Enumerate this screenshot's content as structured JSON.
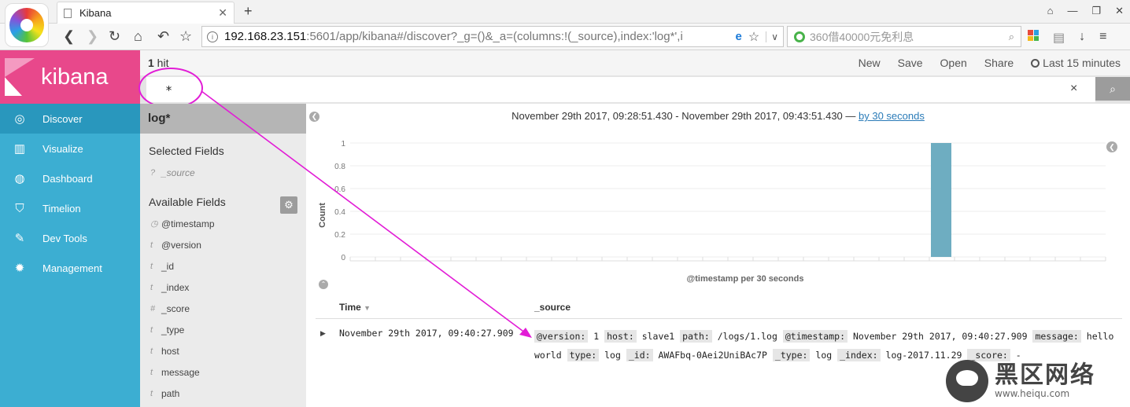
{
  "browser": {
    "tab_title": "Kibana",
    "tab_close": "✕",
    "new_tab": "+",
    "url_host": "192.168.23.151",
    "url_rest": ":5601/app/kibana#/discover?_g=()&_a=(columns:!(_source),index:'log*',i",
    "search_text": "360借40000元免利息"
  },
  "kibana": {
    "logo": "kibana",
    "nav": [
      {
        "label": "Discover",
        "icon": "compass-icon"
      },
      {
        "label": "Visualize",
        "icon": "bar-chart-icon"
      },
      {
        "label": "Dashboard",
        "icon": "gauge-icon"
      },
      {
        "label": "Timelion",
        "icon": "shield-icon"
      },
      {
        "label": "Dev Tools",
        "icon": "wrench-icon"
      },
      {
        "label": "Management",
        "icon": "gear-icon"
      }
    ],
    "hits_count": "1",
    "hits_label": " hit",
    "menu": {
      "new": "New",
      "save": "Save",
      "open": "Open",
      "share": "Share",
      "time": "Last 15 minutes"
    },
    "query": "*",
    "clear": "×",
    "index_pattern": "log*",
    "selected_fields_title": "Selected Fields",
    "selected_fields": [
      {
        "type": "?",
        "name": "_source"
      }
    ],
    "available_fields_title": "Available Fields",
    "available_fields": [
      {
        "type": "clock",
        "name": "@timestamp"
      },
      {
        "type": "t",
        "name": "@version"
      },
      {
        "type": "t",
        "name": "_id"
      },
      {
        "type": "t",
        "name": "_index"
      },
      {
        "type": "#",
        "name": "_score"
      },
      {
        "type": "t",
        "name": "_type"
      },
      {
        "type": "t",
        "name": "host"
      },
      {
        "type": "t",
        "name": "message"
      },
      {
        "type": "t",
        "name": "path"
      }
    ],
    "time_range": "November 29th 2017, 09:28:51.430 - November 29th 2017, 09:43:51.430 — ",
    "interval_link": "by 30 seconds",
    "table_headers": {
      "time": "Time",
      "source": "_source"
    },
    "row": {
      "time": "November 29th 2017, 09:40:27.909",
      "source": [
        {
          "k": "@version:",
          "v": "1"
        },
        {
          "k": "host:",
          "v": "slave1"
        },
        {
          "k": "path:",
          "v": "/logs/1.log"
        },
        {
          "k": "@timestamp:",
          "v": "November 29th 2017, 09:40:27.909"
        },
        {
          "k": "message:",
          "v": "hello world"
        },
        {
          "k": "type:",
          "v": "log"
        },
        {
          "k": "_id:",
          "v": "AWAFbq-0Aei2UniBAc7P"
        },
        {
          "k": "_type:",
          "v": "log"
        },
        {
          "k": "_index:",
          "v": "log-2017.11.29"
        },
        {
          "k": "_score:",
          "v": "-"
        }
      ]
    }
  },
  "chart_data": {
    "type": "bar",
    "ylabel": "Count",
    "xlabel": "@timestamp per 30 seconds",
    "yticks": [
      "0",
      "0.2",
      "0.4",
      "0.6",
      "0.8",
      "1"
    ],
    "ylim": [
      0,
      1
    ],
    "buckets": 30,
    "values": [
      0,
      0,
      0,
      0,
      0,
      0,
      0,
      0,
      0,
      0,
      0,
      0,
      0,
      0,
      0,
      0,
      0,
      0,
      0,
      0,
      0,
      0,
      0,
      1,
      0,
      0,
      0,
      0,
      0,
      0
    ],
    "bar_color": "#6eadc1"
  },
  "colors": {
    "sidebar": "#3caed2",
    "logo_bg": "#e8488b",
    "annotation": "#e21cd6"
  },
  "watermark": {
    "title": "黑区网络",
    "url": "www.heiqu.com"
  }
}
